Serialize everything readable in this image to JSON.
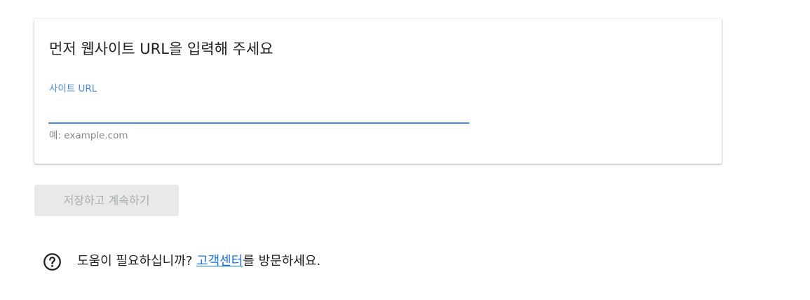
{
  "card": {
    "title": "먼저 웹사이트 URL을 입력해 주세요",
    "field_label": "사이트 URL",
    "input_value": "",
    "hint": "예: example.com"
  },
  "actions": {
    "save_label": "저장하고 계속하기"
  },
  "help": {
    "prefix": "도움이 필요하십니까? ",
    "link_label": "고객센터",
    "suffix": "를 방문하세요.",
    "icon": "help-circle-icon"
  },
  "colors": {
    "accent": "#4a86e8",
    "link": "#1a73e8",
    "button_disabled_bg": "#e8eaea",
    "button_disabled_text": "#a9adb0",
    "hint_text": "#80868b"
  }
}
